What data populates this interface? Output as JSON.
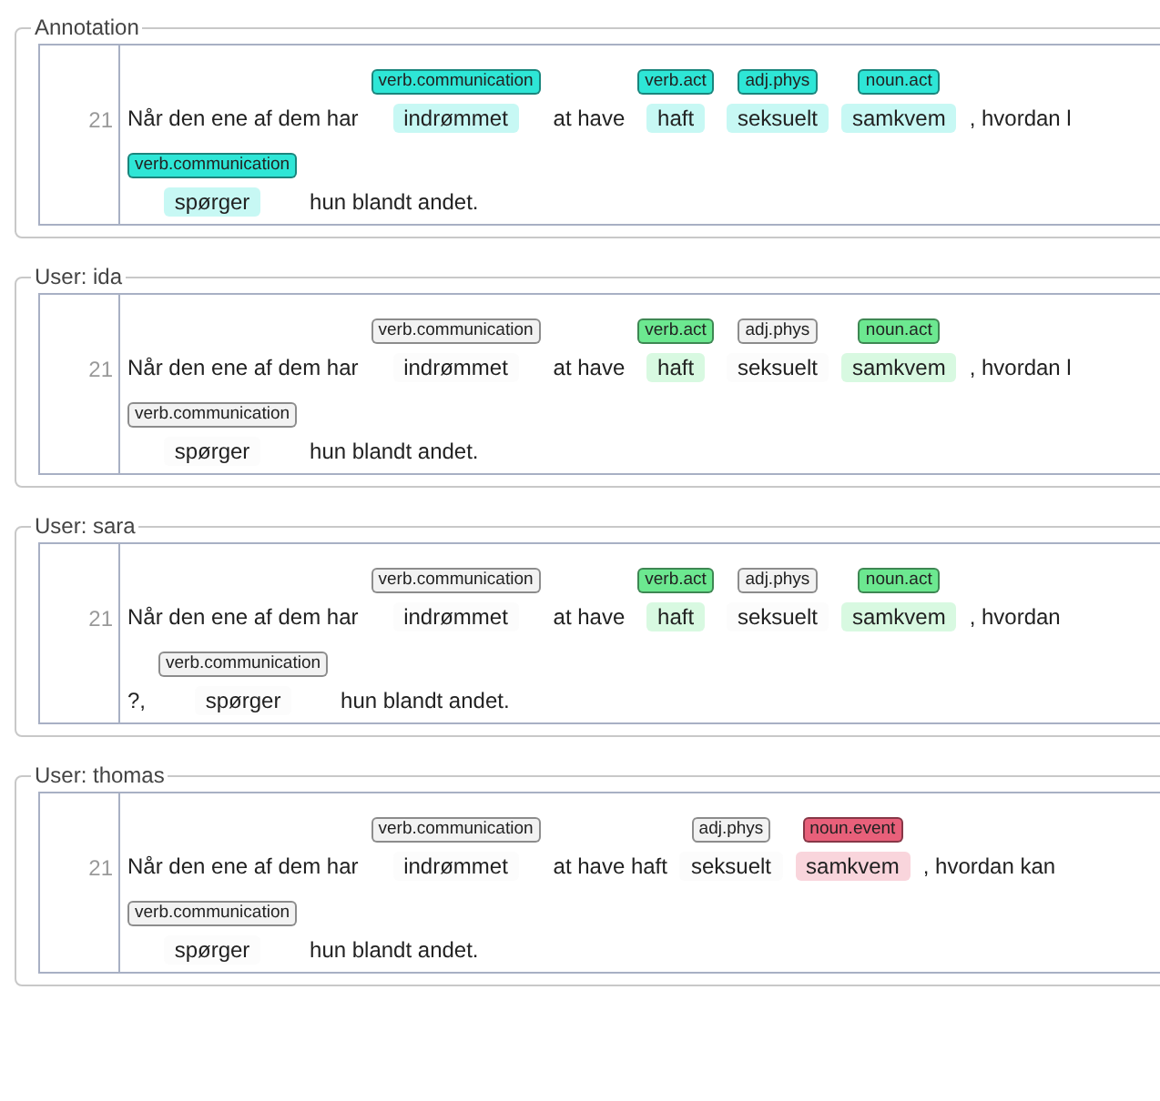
{
  "panels": [
    {
      "legend": "Annotation",
      "line_number": "21",
      "lines": [
        [
          {
            "text": "Når den ene af dem har"
          },
          {
            "text": "indrømmet",
            "label": {
              "text": "verb.communication",
              "color": "#2ee6d6"
            }
          },
          {
            "text": "at have"
          },
          {
            "text": "haft",
            "label": {
              "text": "verb.act",
              "color": "#2ee6d6"
            }
          },
          {
            "text": "seksuelt",
            "label": {
              "text": "adj.phys",
              "color": "#2ee6d6"
            }
          },
          {
            "text": "samkvem",
            "label": {
              "text": "noun.act",
              "color": "#2ee6d6"
            }
          },
          {
            "text": ", hvordan l"
          }
        ],
        [
          {
            "text": "spørger",
            "label": {
              "text": "verb.communication",
              "color": "#2ee6d6"
            }
          },
          {
            "text": "hun blandt andet."
          }
        ]
      ]
    },
    {
      "legend": "User: ida",
      "line_number": "21",
      "lines": [
        [
          {
            "text": "Når den ene af dem har"
          },
          {
            "text": "indrømmet",
            "label": {
              "text": "verb.communication",
              "color": "#f2f2f2"
            }
          },
          {
            "text": "at have"
          },
          {
            "text": "haft",
            "label": {
              "text": "verb.act",
              "color": "#6ce890"
            }
          },
          {
            "text": "seksuelt",
            "label": {
              "text": "adj.phys",
              "color": "#f2f2f2"
            }
          },
          {
            "text": "samkvem",
            "label": {
              "text": "noun.act",
              "color": "#6ce890"
            }
          },
          {
            "text": ", hvordan l"
          }
        ],
        [
          {
            "text": "spørger",
            "label": {
              "text": "verb.communication",
              "color": "#f2f2f2"
            }
          },
          {
            "text": "hun blandt andet."
          }
        ]
      ]
    },
    {
      "legend": "User: sara",
      "line_number": "21",
      "lines": [
        [
          {
            "text": "Når den ene af dem har"
          },
          {
            "text": "indrømmet",
            "label": {
              "text": "verb.communication",
              "color": "#f2f2f2"
            }
          },
          {
            "text": "at have"
          },
          {
            "text": "haft",
            "label": {
              "text": "verb.act",
              "color": "#6ce890"
            }
          },
          {
            "text": "seksuelt",
            "label": {
              "text": "adj.phys",
              "color": "#f2f2f2"
            }
          },
          {
            "text": "samkvem",
            "label": {
              "text": "noun.act",
              "color": "#6ce890"
            }
          },
          {
            "text": ", hvordan"
          }
        ],
        [
          {
            "text": "?,"
          },
          {
            "text": "spørger",
            "label": {
              "text": "verb.communication",
              "color": "#f2f2f2"
            }
          },
          {
            "text": "hun blandt andet."
          }
        ]
      ]
    },
    {
      "legend": "User: thomas",
      "line_number": "21",
      "lines": [
        [
          {
            "text": "Når den ene af dem har"
          },
          {
            "text": "indrømmet",
            "label": {
              "text": "verb.communication",
              "color": "#f2f2f2"
            }
          },
          {
            "text": "at have haft"
          },
          {
            "text": "seksuelt",
            "label": {
              "text": "adj.phys",
              "color": "#f2f2f2"
            }
          },
          {
            "text": "samkvem",
            "label": {
              "text": "noun.event",
              "color": "#e8607a"
            }
          },
          {
            "text": ", hvordan kan"
          }
        ],
        [
          {
            "text": "spørger",
            "label": {
              "text": "verb.communication",
              "color": "#f2f2f2"
            }
          },
          {
            "text": "hun blandt andet."
          }
        ]
      ]
    }
  ]
}
